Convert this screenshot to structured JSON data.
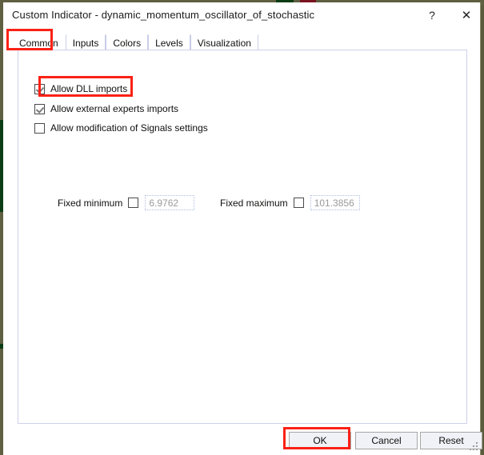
{
  "window": {
    "title": "Custom Indicator - dynamic_momentum_oscillator_of_stochastic",
    "help_icon": "?",
    "close_icon": "✕"
  },
  "tabs": [
    {
      "label": "Common",
      "active": true
    },
    {
      "label": "Inputs",
      "active": false
    },
    {
      "label": "Colors",
      "active": false
    },
    {
      "label": "Levels",
      "active": false
    },
    {
      "label": "Visualization",
      "active": false
    }
  ],
  "checkboxes": [
    {
      "label": "Allow DLL imports",
      "checked": true
    },
    {
      "label": "Allow external experts imports",
      "checked": true
    },
    {
      "label": "Allow modification of Signals settings",
      "checked": false
    }
  ],
  "fixed_minimum": {
    "label": "Fixed minimum",
    "checked": false,
    "value": "6.9762"
  },
  "fixed_maximum": {
    "label": "Fixed maximum",
    "checked": false,
    "value": "101.3856"
  },
  "buttons": {
    "ok": "OK",
    "cancel": "Cancel",
    "reset": "Reset"
  },
  "annotations": {
    "accent_color": "#fb2116",
    "highlighted": [
      "Common",
      "Allow DLL imports",
      "OK"
    ]
  }
}
